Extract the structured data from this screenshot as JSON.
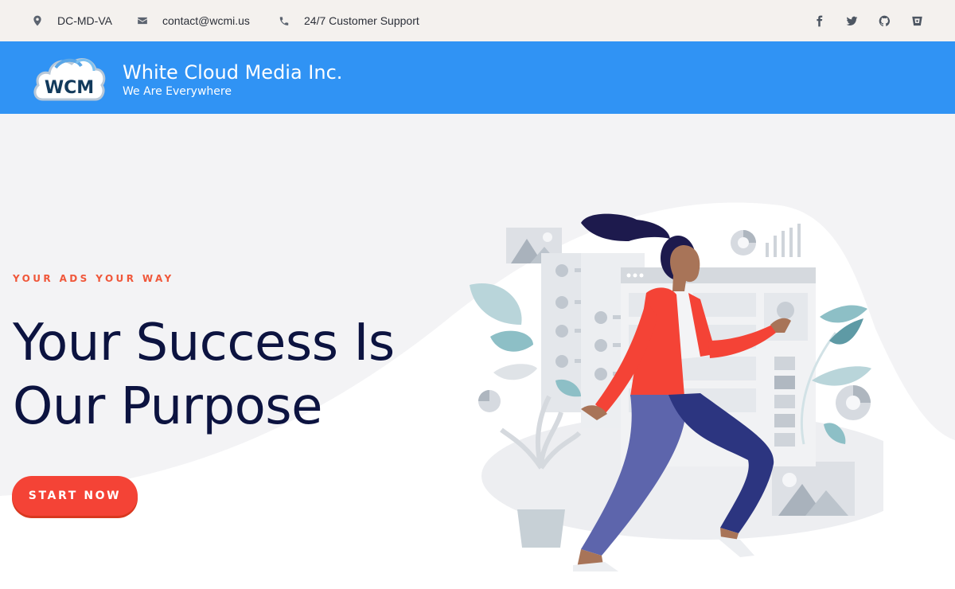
{
  "topbar": {
    "location": "DC-MD-VA",
    "email": "contact@wcmi.us",
    "support": "24/7 Customer Support",
    "social_icons": [
      "facebook-icon",
      "twitter-icon",
      "github-icon",
      "bitbucket-icon"
    ]
  },
  "brand": {
    "logo_text": "WCM",
    "title": "White Cloud Media Inc.",
    "tagline": "We Are Everywhere"
  },
  "hero": {
    "eyebrow": "YOUR ADS YOUR WAY",
    "headline_line1": "Your Success Is",
    "headline_line2": "Our Purpose",
    "cta_label": "START NOW"
  },
  "colors": {
    "brand_bar": "#3093f4",
    "accent": "#f44336",
    "headline": "#0c1340",
    "topbar": "#f4f1ee"
  }
}
